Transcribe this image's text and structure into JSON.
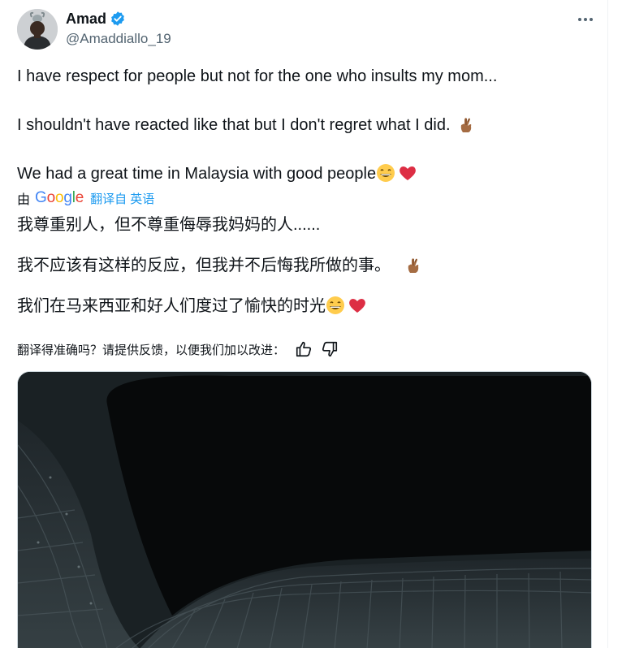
{
  "author": {
    "display_name": "Amad",
    "handle": "@Amaddiallo_19",
    "verified": true,
    "verified_icon": "verified-badge-icon",
    "accent_color": "#1d9bf0"
  },
  "tweet": {
    "lines": [
      "I have respect for people but not for the one who insults my mom...",
      "I shouldn't have reacted like that but I don't regret what I did.",
      "We had a great time in Malaysia with good people"
    ],
    "emojis": {
      "line2": "crossed-fingers-emoji",
      "line3": [
        "grinning-face-emoji",
        "red-heart-emoji"
      ]
    }
  },
  "translation": {
    "by_label": "由",
    "provider": "Google",
    "translated_from": "翻译自 英语",
    "lines": [
      "我尊重别人，但不尊重侮辱我妈妈的人......",
      "我不应该有这样的反应，但我并不后悔我所做的事。",
      "我们在马来西亚和好人们度过了愉快的时光"
    ]
  },
  "feedback": {
    "prompt": "翻译得准确吗？请提供反馈，以便我们加以改进：",
    "thumbs_up_icon": "thumbs-up-icon",
    "thumbs_down_icon": "thumbs-down-icon"
  },
  "menu": {
    "more_icon": "more-options-icon"
  },
  "media": {
    "description_icon": "stadium-photo"
  }
}
